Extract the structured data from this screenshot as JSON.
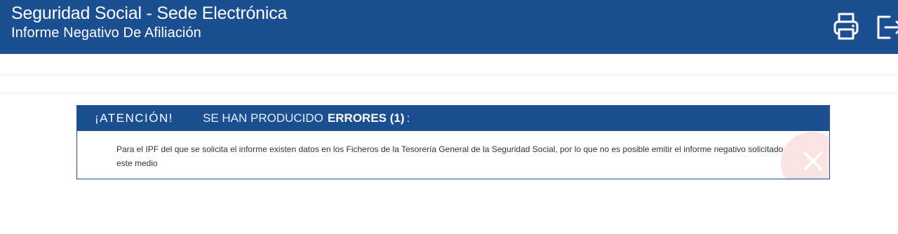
{
  "header": {
    "title": "Seguridad Social - Sede Electrónica",
    "subtitle": "Informe Negativo De Afiliación",
    "icons": [
      "printer-icon",
      "logout-icon"
    ]
  },
  "alert": {
    "attention": "¡ATENCIÓN!",
    "message": "SE HAN PRODUCIDO",
    "errors": "ERRORES (1)",
    "colon": ":",
    "body": "Para el IPF del que se solicita el informe existen datos en los Ficheros de la Tesorería General de la Seguridad Social, por lo que no es posible emitir el informe negativo solicitado por este medio",
    "close_icon": "close-icon"
  },
  "colors": {
    "brand": "#1c4f91",
    "close_bg": "#fbe3e3"
  }
}
